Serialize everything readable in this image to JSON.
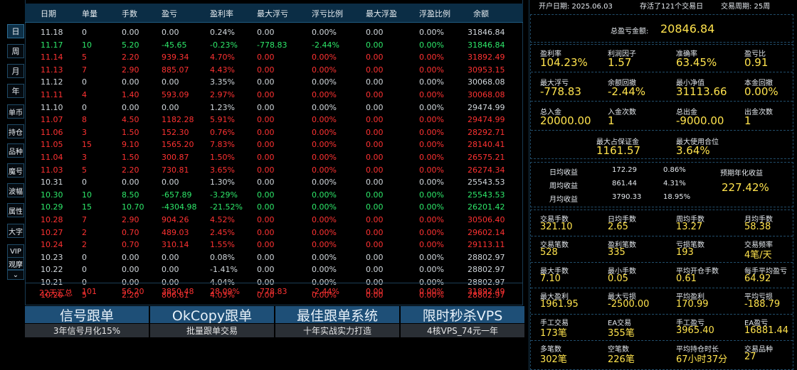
{
  "sidebar": {
    "buttons": [
      "日",
      "周",
      "月",
      "年",
      "单币",
      "持仓",
      "品种",
      "魔号",
      "波幅",
      "属性",
      "大字",
      "VIP",
      "观摩"
    ],
    "collapse": "⌄"
  },
  "table": {
    "headers": [
      "日期",
      "单量",
      "手数",
      "盈亏",
      "盈利率",
      "最大浮亏",
      "浮亏比例",
      "最大浮盈",
      "浮盈比例",
      "余额"
    ],
    "rows": [
      {
        "date": "11.18",
        "orders": "0",
        "lots": "0.00",
        "pnl": "0.00",
        "rate": "0.24%",
        "maxdd": "0.00",
        "ddpct": "0.00%",
        "maxfp": "0.00",
        "fppct": "0.00%",
        "bal": "31846.84",
        "c": "w"
      },
      {
        "date": "11.17",
        "orders": "10",
        "lots": "5.20",
        "pnl": "-45.65",
        "rate": "-0.23%",
        "maxdd": "-778.83",
        "ddpct": "-2.44%",
        "maxfp": "0.00",
        "fppct": "0.00%",
        "bal": "31846.84",
        "c": "g"
      },
      {
        "date": "11.14",
        "orders": "5",
        "lots": "2.20",
        "pnl": "939.34",
        "rate": "4.70%",
        "maxdd": "0.00",
        "ddpct": "0.00%",
        "maxfp": "0.00",
        "fppct": "0.00%",
        "bal": "31892.49",
        "c": "r"
      },
      {
        "date": "11.13",
        "orders": "7",
        "lots": "2.90",
        "pnl": "885.07",
        "rate": "4.43%",
        "maxdd": "0.00",
        "ddpct": "0.00%",
        "maxfp": "0.00",
        "fppct": "0.00%",
        "bal": "30953.15",
        "c": "r"
      },
      {
        "date": "11.12",
        "orders": "0",
        "lots": "0.00",
        "pnl": "0.00",
        "rate": "3.35%",
        "maxdd": "0.00",
        "ddpct": "0.00%",
        "maxfp": "0.00",
        "fppct": "0.00%",
        "bal": "30068.08",
        "c": "w"
      },
      {
        "date": "11.11",
        "orders": "4",
        "lots": "1.40",
        "pnl": "593.09",
        "rate": "2.97%",
        "maxdd": "0.00",
        "ddpct": "0.00%",
        "maxfp": "0.00",
        "fppct": "0.00%",
        "bal": "30068.08",
        "c": "r"
      },
      {
        "date": "11.10",
        "orders": "0",
        "lots": "0.00",
        "pnl": "0.00",
        "rate": "1.23%",
        "maxdd": "0.00",
        "ddpct": "0.00%",
        "maxfp": "0.00",
        "fppct": "0.00%",
        "bal": "29474.99",
        "c": "w"
      },
      {
        "date": "11.07",
        "orders": "8",
        "lots": "4.50",
        "pnl": "1182.28",
        "rate": "5.91%",
        "maxdd": "0.00",
        "ddpct": "0.00%",
        "maxfp": "0.00",
        "fppct": "0.00%",
        "bal": "29474.99",
        "c": "r"
      },
      {
        "date": "11.06",
        "orders": "3",
        "lots": "1.50",
        "pnl": "152.30",
        "rate": "0.76%",
        "maxdd": "0.00",
        "ddpct": "0.00%",
        "maxfp": "0.00",
        "fppct": "0.00%",
        "bal": "28292.71",
        "c": "r"
      },
      {
        "date": "11.05",
        "orders": "15",
        "lots": "9.10",
        "pnl": "1565.20",
        "rate": "7.83%",
        "maxdd": "0.00",
        "ddpct": "0.00%",
        "maxfp": "0.00",
        "fppct": "0.00%",
        "bal": "28140.41",
        "c": "r"
      },
      {
        "date": "11.04",
        "orders": "3",
        "lots": "1.50",
        "pnl": "300.87",
        "rate": "1.50%",
        "maxdd": "0.00",
        "ddpct": "0.00%",
        "maxfp": "0.00",
        "fppct": "0.00%",
        "bal": "26575.21",
        "c": "r"
      },
      {
        "date": "11.03",
        "orders": "5",
        "lots": "2.20",
        "pnl": "730.81",
        "rate": "3.65%",
        "maxdd": "0.00",
        "ddpct": "0.00%",
        "maxfp": "0.00",
        "fppct": "0.00%",
        "bal": "26274.34",
        "c": "r"
      },
      {
        "date": "10.31",
        "orders": "0",
        "lots": "0.00",
        "pnl": "0.00",
        "rate": "1.30%",
        "maxdd": "0.00",
        "ddpct": "0.00%",
        "maxfp": "0.00",
        "fppct": "0.00%",
        "bal": "25543.53",
        "c": "w"
      },
      {
        "date": "10.30",
        "orders": "10",
        "lots": "8.50",
        "pnl": "-657.89",
        "rate": "-3.29%",
        "maxdd": "0.00",
        "ddpct": "0.00%",
        "maxfp": "0.00",
        "fppct": "0.00%",
        "bal": "25543.53",
        "c": "g"
      },
      {
        "date": "10.29",
        "orders": "15",
        "lots": "10.70",
        "pnl": "-4304.98",
        "rate": "-21.52%",
        "maxdd": "0.00",
        "ddpct": "0.00%",
        "maxfp": "0.00",
        "fppct": "0.00%",
        "bal": "26201.42",
        "c": "g"
      },
      {
        "date": "10.28",
        "orders": "7",
        "lots": "2.90",
        "pnl": "904.26",
        "rate": "4.52%",
        "maxdd": "0.00",
        "ddpct": "0.00%",
        "maxfp": "0.00",
        "fppct": "0.00%",
        "bal": "30506.40",
        "c": "r"
      },
      {
        "date": "10.27",
        "orders": "2",
        "lots": "0.70",
        "pnl": "489.03",
        "rate": "2.45%",
        "maxdd": "0.00",
        "ddpct": "0.00%",
        "maxfp": "0.00",
        "fppct": "0.00%",
        "bal": "29602.14",
        "c": "r"
      },
      {
        "date": "10.24",
        "orders": "2",
        "lots": "0.70",
        "pnl": "310.14",
        "rate": "1.55%",
        "maxdd": "0.00",
        "ddpct": "0.00%",
        "maxfp": "0.00",
        "fppct": "0.00%",
        "bal": "29113.11",
        "c": "r"
      },
      {
        "date": "10.23",
        "orders": "0",
        "lots": "0.00",
        "pnl": "0.00",
        "rate": "0.08%",
        "maxdd": "0.00",
        "ddpct": "0.00%",
        "maxfp": "0.00",
        "fppct": "0.00%",
        "bal": "28802.97",
        "c": "w"
      },
      {
        "date": "10.22",
        "orders": "0",
        "lots": "0.00",
        "pnl": "0.00",
        "rate": "-1.41%",
        "maxdd": "0.00",
        "ddpct": "0.00%",
        "maxfp": "0.00",
        "fppct": "0.00%",
        "bal": "28802.97",
        "c": "w"
      },
      {
        "date": "10.21",
        "orders": "0",
        "lots": "0.00",
        "pnl": "0.00",
        "rate": "4.04%",
        "maxdd": "0.00",
        "ddpct": "0.00%",
        "maxfp": "0.00",
        "fppct": "0.00%",
        "bal": "28802.97",
        "c": "w"
      },
      {
        "date": "10.20",
        "orders": "5",
        "lots": "2.20",
        "pnl": "806.61",
        "rate": "4.03%",
        "maxdd": "0.00",
        "ddpct": "0.00%",
        "maxfp": "0.00",
        "fppct": "0.00%",
        "bal": "28802.97",
        "c": "r"
      }
    ],
    "summary": {
      "date": "22天汇总",
      "orders": "101",
      "lots": "56.20",
      "pnl": "3850.48",
      "rate": "28.09%",
      "maxdd": "-778.83",
      "ddpct": "-2.44%",
      "maxfp": "0.00",
      "fppct": "0.00%",
      "bal": "31892.49",
      "c": "r"
    }
  },
  "ads": [
    {
      "title": "信号跟单",
      "sub": "3年信号月化15%"
    },
    {
      "title": "OkCopy跟单",
      "sub": "批量跟单交易"
    },
    {
      "title": "最佳跟单系统",
      "sub": "十年实战实力打造"
    },
    {
      "title": "限时秒杀VPS",
      "sub": "4核VPS_74元一年"
    }
  ],
  "stats": {
    "top": {
      "open_date": "开户日期: 2025.06.03",
      "alive": "存活了121个交易日",
      "period": "交易周期: 25周"
    },
    "total_label": "总盈亏金额:",
    "total_value": "20846.84",
    "g1": [
      {
        "label": "盈利率",
        "value": "104.23%"
      },
      {
        "label": "利润因子",
        "value": "1.57"
      },
      {
        "label": "准确率",
        "value": "63.45%"
      },
      {
        "label": "盈亏比",
        "value": "0.91"
      },
      {
        "label": "最大浮亏",
        "value": "-778.83"
      },
      {
        "label": "余额回撤",
        "value": "-2.44%"
      },
      {
        "label": "最小净值",
        "value": "31113.66"
      },
      {
        "label": "本金回撤",
        "value": "0.00%"
      },
      {
        "label": "总入金",
        "value": "20000.00"
      },
      {
        "label": "入金次数",
        "value": "1"
      },
      {
        "label": "总出金",
        "value": "-9000.00"
      },
      {
        "label": "出金次数",
        "value": "1"
      }
    ],
    "margin": [
      {
        "label": "最大占保证金",
        "value": "1161.57"
      },
      {
        "label": "最大使用合位",
        "value": "3.64%"
      }
    ],
    "avg": [
      {
        "label": "日均收益",
        "amt": "172.29",
        "pct": "0.86%"
      },
      {
        "label": "周均收益",
        "amt": "861.44",
        "pct": "4.31%"
      },
      {
        "label": "月均收益",
        "amt": "3790.33",
        "pct": "18.95%"
      }
    ],
    "annual": {
      "label": "预期年化收益",
      "value": "227.42%"
    },
    "g2": [
      {
        "label": "交易手数",
        "value": "321.10"
      },
      {
        "label": "日均手数",
        "value": "2.65"
      },
      {
        "label": "周均手数",
        "value": "13.27"
      },
      {
        "label": "月均手数",
        "value": "58.38"
      },
      {
        "label": "交易笔数",
        "value": "528"
      },
      {
        "label": "盈利笔数",
        "value": "335"
      },
      {
        "label": "亏损笔数",
        "value": "193"
      },
      {
        "label": "交易频率",
        "value": "4笔/天"
      },
      {
        "label": "最大手数",
        "value": "7.10"
      },
      {
        "label": "最小手数",
        "value": "0.05"
      },
      {
        "label": "平均开仓手数",
        "value": "0.61"
      },
      {
        "label": "每手平均盈亏",
        "value": "64.92"
      },
      {
        "label": "最大盈利",
        "value": "1961.95"
      },
      {
        "label": "最大亏损",
        "value": "-2500.00"
      },
      {
        "label": "平均盈利",
        "value": "170.99"
      },
      {
        "label": "平均亏损",
        "value": "-188.79"
      },
      {
        "label": "手工交易",
        "value": "173笔"
      },
      {
        "label": "EA交易",
        "value": "355笔"
      },
      {
        "label": "手工盈亏",
        "value": "3965.40"
      },
      {
        "label": "EA盈亏",
        "value": "16881.44"
      },
      {
        "label": "多笔数",
        "value": "302笔"
      },
      {
        "label": "空笔数",
        "value": "226笔"
      },
      {
        "label": "平均持仓时长",
        "value": "67小时37分"
      },
      {
        "label": "交易品种",
        "value": "27"
      }
    ]
  }
}
